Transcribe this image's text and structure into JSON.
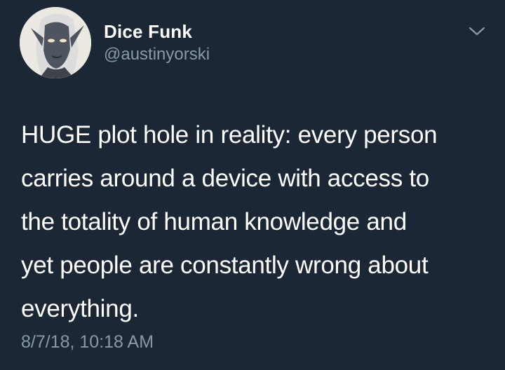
{
  "author": {
    "display_name": "Dice Funk",
    "handle": "@austinyorski"
  },
  "tweet": {
    "lines": [
      "HUGE plot hole in reality: every person",
      "carries around a device with access to",
      "the totality of human knowledge and",
      "yet people are constantly wrong about",
      "everything."
    ],
    "timestamp": "8/7/18, 10:18 AM"
  },
  "icons": {
    "menu": "chevron-down-icon",
    "avatar": "avatar"
  },
  "colors": {
    "background": "#1b2735",
    "text_primary": "#ffffff",
    "text_secondary": "#8a99a8"
  }
}
